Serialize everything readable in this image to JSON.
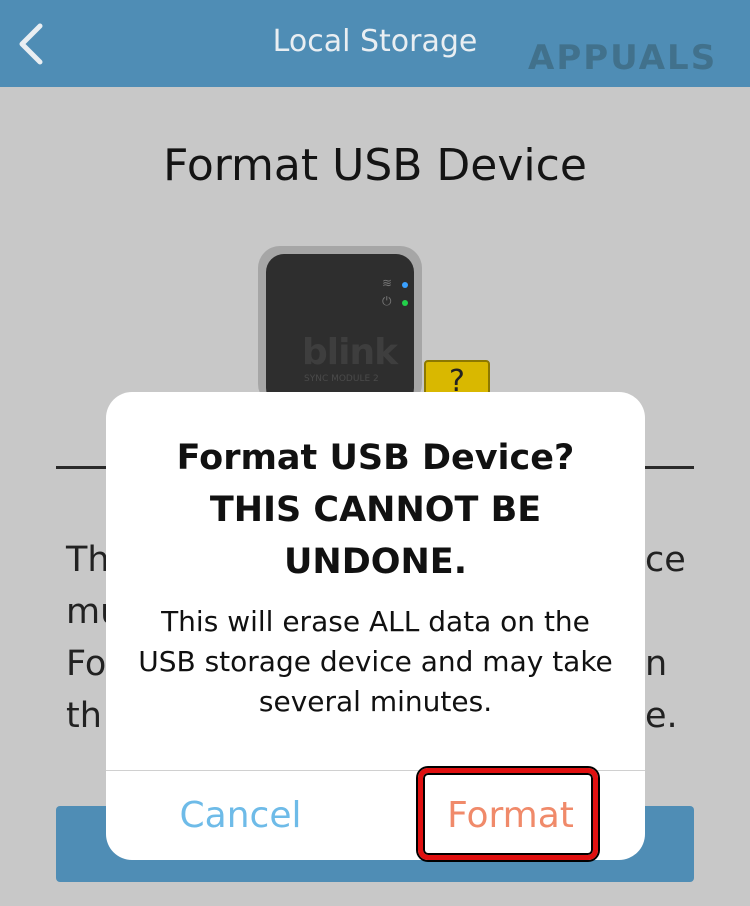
{
  "header": {
    "title": "Local Storage",
    "background": "#4f8db5",
    "back_icon": "chevron-left-icon"
  },
  "watermark": {
    "text": "APPUALS"
  },
  "page": {
    "title": "Format USB Device",
    "device": {
      "logo": "blink",
      "sub": "SYNC MODULE 2",
      "usb_tag": "?"
    },
    "body_fragments": {
      "line1_left": "Th",
      "line1_right": "ce",
      "line2_left": "mu",
      "line3_left": "Fo",
      "line3_right": "n",
      "line4_left": "th",
      "line4_right": "e."
    }
  },
  "dialog": {
    "title": "Format USB Device? THIS CANNOT BE UNDONE.",
    "title_lines": [
      "Format USB Device?",
      "THIS CANNOT BE",
      "UNDONE."
    ],
    "message": "This will erase ALL data on the USB storage device and may take several minutes.",
    "cancel_label": "Cancel",
    "format_label": "Format",
    "cancel_color": "#6ebbe8",
    "format_color": "#f08a6a",
    "highlight_color": "#e01010"
  }
}
